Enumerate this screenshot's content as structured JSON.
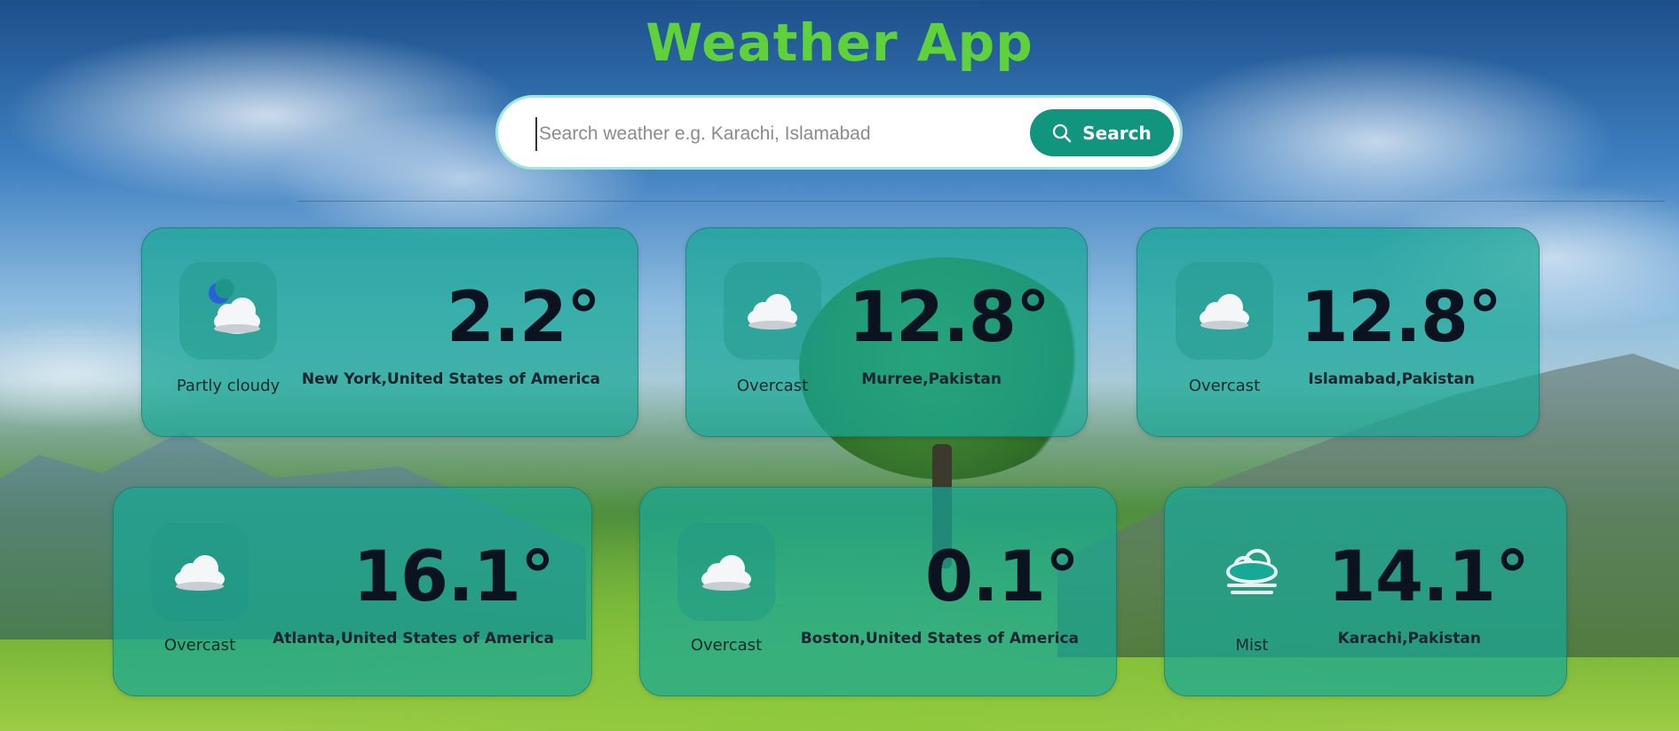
{
  "app": {
    "title": "Weather App"
  },
  "search": {
    "placeholder": "Search weather e.g. Karachi, Islamabad",
    "value": "",
    "button_label": "Search"
  },
  "colors": {
    "title": "#5fd13b",
    "button": "#12957f",
    "card": "#18a896",
    "temperature_text": "#0b1320"
  },
  "cards": [
    {
      "condition": "Partly cloudy",
      "icon": "partly-cloudy-night-icon",
      "temperature": "2.2°",
      "location": "New York,United States of America"
    },
    {
      "condition": "Overcast",
      "icon": "cloud-icon",
      "temperature": "12.8°",
      "location": "Murree,Pakistan"
    },
    {
      "condition": "Overcast",
      "icon": "cloud-icon",
      "temperature": "12.8°",
      "location": "Islamabad,Pakistan"
    },
    {
      "condition": "Overcast",
      "icon": "cloud-icon",
      "temperature": "16.1°",
      "location": "Atlanta,United States of America"
    },
    {
      "condition": "Overcast",
      "icon": "cloud-icon",
      "temperature": "0.1°",
      "location": "Boston,United States of America"
    },
    {
      "condition": "Mist",
      "icon": "mist-icon",
      "temperature": "14.1°",
      "location": "Karachi,Pakistan"
    }
  ]
}
